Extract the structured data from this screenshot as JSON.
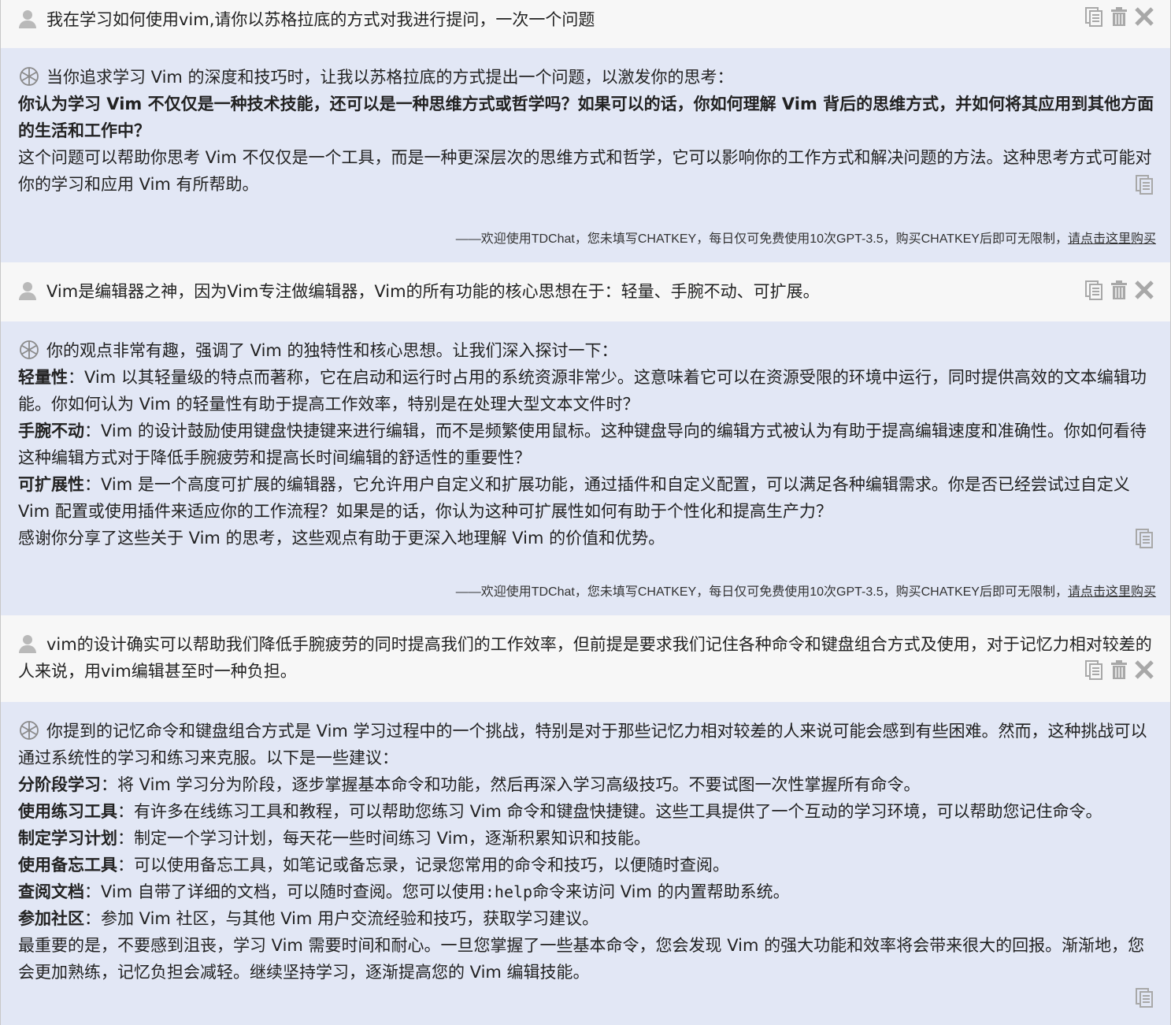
{
  "messages": [
    {
      "role": "user",
      "text": "我在学习如何使用vim,请你以苏格拉底的方式对我进行提问，一次一个问题"
    },
    {
      "role": "assistant",
      "intro": "当你追求学习 Vim 的深度和技巧时，让我以苏格拉底的方式提出一个问题，以激发你的思考：",
      "question": "你认为学习 Vim 不仅仅是一种技术技能，还可以是一种思维方式或哲学吗？如果可以的话，你如何理解 Vim 背后的思维方式，并如何将其应用到其他方面的生活和工作中？",
      "body": "这个问题可以帮助你思考 Vim 不仅仅是一个工具，而是一种更深层次的思维方式和哲学，它可以影响你的工作方式和解决问题的方法。这种思考方式可能对你的学习和应用 Vim 有所帮助。",
      "footer": "——欢迎使用TDChat，您未填写CHATKEY，每日仅可免费使用10次GPT-3.5，购买CHATKEY后即可无限制，",
      "footer_link": "请点击这里购买"
    },
    {
      "role": "user",
      "text": "Vim是编辑器之神，因为Vim专注做编辑器，Vim的所有功能的核心思想在于：轻量、手腕不动、可扩展。"
    },
    {
      "role": "assistant",
      "intro": "你的观点非常有趣，强调了 Vim 的独特性和核心思想。让我们深入探讨一下：",
      "points": [
        {
          "term": "轻量性",
          "text": "：Vim 以其轻量级的特点而著称，它在启动和运行时占用的系统资源非常少。这意味着它可以在资源受限的环境中运行，同时提供高效的文本编辑功能。你如何认为 Vim 的轻量性有助于提高工作效率，特别是在处理大型文本文件时？"
        },
        {
          "term": "手腕不动",
          "text": "：Vim 的设计鼓励使用键盘快捷键来进行编辑，而不是频繁使用鼠标。这种键盘导向的编辑方式被认为有助于提高编辑速度和准确性。你如何看待这种编辑方式对于降低手腕疲劳和提高长时间编辑的舒适性的重要性？"
        },
        {
          "term": "可扩展性",
          "text": "：Vim 是一个高度可扩展的编辑器，它允许用户自定义和扩展功能，通过插件和自定义配置，可以满足各种编辑需求。你是否已经尝试过自定义 Vim 配置或使用插件来适应你的工作流程？如果是的话，你认为这种可扩展性如何有助于个性化和提高生产力？"
        }
      ],
      "outro": "感谢你分享了这些关于 Vim 的思考，这些观点有助于更深入地理解 Vim 的价值和优势。",
      "footer": "——欢迎使用TDChat，您未填写CHATKEY，每日仅可免费使用10次GPT-3.5，购买CHATKEY后即可无限制，",
      "footer_link": "请点击这里购买"
    },
    {
      "role": "user",
      "text": "vim的设计确实可以帮助我们降低手腕疲劳的同时提高我们的工作效率，但前提是要求我们记住各种命令和键盘组合方式及使用，对于记忆力相对较差的人来说，用vim编辑甚至时一种负担。"
    },
    {
      "role": "assistant",
      "intro": "你提到的记忆命令和键盘组合方式是 Vim 学习过程中的一个挑战，特别是对于那些记忆力相对较差的人来说可能会感到有些困难。然而，这种挑战可以通过系统性的学习和练习来克服。以下是一些建议：",
      "points": [
        {
          "term": "分阶段学习",
          "text": "：将 Vim 学习分为阶段，逐步掌握基本命令和功能，然后再深入学习高级技巧。不要试图一次性掌握所有命令。"
        },
        {
          "term": "使用练习工具",
          "text": "：有许多在线练习工具和教程，可以帮助您练习 Vim 命令和键盘快捷键。这些工具提供了一个互动的学习环境，可以帮助您记住命令。"
        },
        {
          "term": "制定学习计划",
          "text": "：制定一个学习计划，每天花一些时间练习 Vim，逐渐积累知识和技能。"
        },
        {
          "term": "使用备忘工具",
          "text": "：可以使用备忘工具，如笔记或备忘录，记录您常用的命令和技巧，以便随时查阅。"
        },
        {
          "term": "查阅文档",
          "text_before": "：Vim 自带了详细的文档，可以随时查阅。您可以使用",
          "code": ":help",
          "text_after": "命令来访问 Vim 的内置帮助系统。"
        },
        {
          "term": "参加社区",
          "text": "：参加 Vim 社区，与其他 Vim 用户交流经验和技巧，获取学习建议。"
        }
      ],
      "outro": "最重要的是，不要感到沮丧，学习 Vim 需要时间和耐心。一旦您掌握了一些基本命令，您会发现 Vim 的强大功能和效率将会带来很大的回报。渐渐地，您会更加熟练，记忆负担会减轻。继续坚持学习，逐渐提高您的 Vim 编辑技能。"
    }
  ],
  "icons": {
    "copy": "copy-icon",
    "delete": "trash-icon",
    "close": "close-icon",
    "user_avatar": "user-avatar-icon",
    "bot_avatar": "openai-logo-icon"
  },
  "colors": {
    "user_bg": "#f7f7f7",
    "bot_bg": "#e2e7f5",
    "icon": "#a8a8a8"
  }
}
